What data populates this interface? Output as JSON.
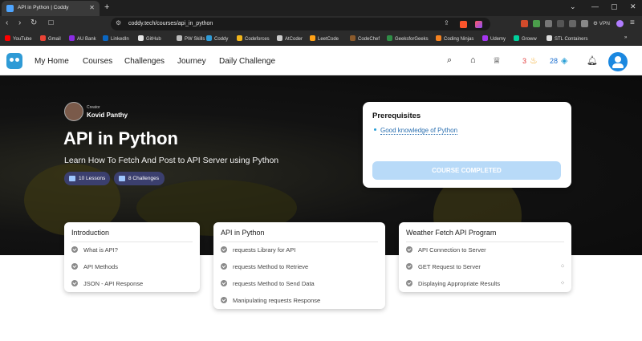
{
  "browser": {
    "tab_title": "API in Python | Coddy",
    "url": "coddy.tech/courses/api_in_python",
    "bookmarks": [
      {
        "label": "YouTube",
        "color": "#ff0000"
      },
      {
        "label": "Gmail",
        "color": "#ea4335"
      },
      {
        "label": "AU Bank",
        "color": "#8a2be2"
      },
      {
        "label": "LinkedIn",
        "color": "#0a66c2"
      },
      {
        "label": "GitHub",
        "color": "#e6e6e6"
      },
      {
        "label": "PW Skills",
        "color": "#bbbbbb"
      },
      {
        "label": "Coddy",
        "color": "#2f9bd6"
      },
      {
        "label": "Codeforces",
        "color": "#f2b61b"
      },
      {
        "label": "AtCoder",
        "color": "#cccccc"
      },
      {
        "label": "LeetCode",
        "color": "#ffa116"
      },
      {
        "label": "CodeChef",
        "color": "#8b5a2b"
      },
      {
        "label": "GeeksforGeeks",
        "color": "#2f8d46"
      },
      {
        "label": "Coding Ninjas",
        "color": "#f58220"
      },
      {
        "label": "Udemy",
        "color": "#a435f0"
      },
      {
        "label": "Groww",
        "color": "#00d09c"
      },
      {
        "label": "STL Containers",
        "color": "#dddddd"
      }
    ],
    "vpn_label": "VPN"
  },
  "header": {
    "nav": [
      "My Home",
      "Courses",
      "Challenges",
      "Journey",
      "Daily Challenge"
    ],
    "streak": "3",
    "gems": "28"
  },
  "course": {
    "creator_label": "Creator",
    "creator_name": "Kovid Panthy",
    "title": "API in Python",
    "subtitle": "Learn How To Fetch And Post to API Server using Python",
    "lessons_label": "10 Lessons",
    "challenges_label": "8 Challenges"
  },
  "prerequisites": {
    "heading": "Prerequisites",
    "items": [
      "Good knowledge of Python"
    ],
    "button_label": "COURSE COMPLETED"
  },
  "modules": [
    {
      "title": "Introduction",
      "lessons": [
        "What is API?",
        "API Methods",
        "JSON - API Response"
      ]
    },
    {
      "title": "API in Python",
      "lessons": [
        "requests Library for API",
        "requests Method to Retrieve",
        "requests Method to Send Data",
        "Manipulating requests Response"
      ]
    },
    {
      "title": "Weather Fetch API Program",
      "lessons": [
        "API Connection to Server",
        "GET Request to Server",
        "Displaying Appropriate Results"
      ]
    }
  ],
  "colors": {
    "accent": "#1b88e0",
    "pill": "#3b3f6e",
    "completed_btn": "#b8daf8"
  }
}
